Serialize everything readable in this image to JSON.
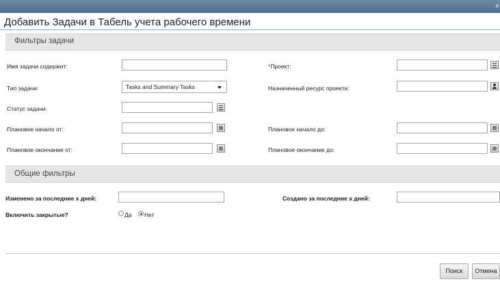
{
  "dialog": {
    "title": "Добавить Задачи в Табель учета рабочего времени",
    "close_glyph": "x"
  },
  "task_filters": {
    "header": "Фильтры задачи",
    "task_name_label": "Имя задачи содержит:",
    "task_name_value": "",
    "project_required_mark": "*",
    "project_label": "Проект:",
    "project_value": "",
    "task_type_label": "Тип задачи:",
    "task_type_selected": "Tasks and Summary Tasks",
    "assigned_resource_label": "Назначенный ресурс проекта:",
    "assigned_resource_value": "",
    "task_status_label": "Статус задачи:",
    "task_status_value": "",
    "planned_start_from_label": "Плановое начало от:",
    "planned_start_from_value": "",
    "planned_start_to_label": "Плановое начало до:",
    "planned_start_to_value": "",
    "planned_finish_from_label": "Плановое окончание от:",
    "planned_finish_from_value": "",
    "planned_finish_to_label": "Плановое окончание до:",
    "planned_finish_to_value": ""
  },
  "general_filters": {
    "header": "Общие фильтры",
    "modified_label": "Изменено за последние x дней:",
    "modified_value": "",
    "created_label": "Создано за последние x дней:",
    "created_value": "",
    "include_closed_label": "Включить закрытые?",
    "option_yes": "Да",
    "option_no": "Нет",
    "selected_option": "Нет"
  },
  "footer": {
    "search_label": "Поиск",
    "cancel_label": "Отмена"
  },
  "colors": {
    "title_bar": "#5c7a98",
    "section_header": "#e6e6e6",
    "required": "#d01818"
  },
  "icons": [
    "list-icon",
    "user-icon",
    "calendar-icon",
    "radio-button",
    "chevron-down-icon"
  ]
}
